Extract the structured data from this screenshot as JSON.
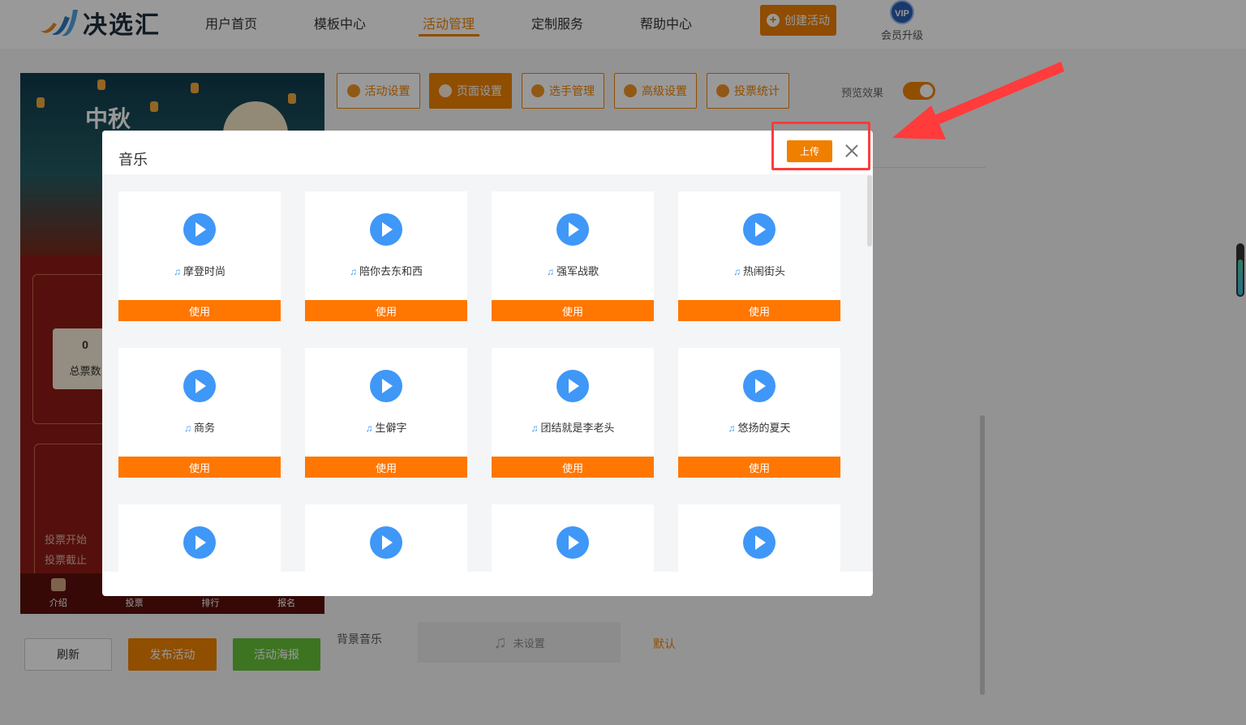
{
  "header": {
    "logo_text": "决选汇",
    "nav": [
      "用户首页",
      "模板中心",
      "活动管理",
      "定制服务",
      "帮助中心"
    ],
    "active_nav": "活动管理",
    "create_button": "创建活动",
    "vip_badge": "VIP",
    "vip_label": "会员升级"
  },
  "toolbar": {
    "buttons": [
      "活动设置",
      "页面设置",
      "选手管理",
      "高级设置",
      "投票统计"
    ],
    "active": "页面设置",
    "preview_label": "预览效果",
    "preview_on": true
  },
  "phone_preview": {
    "banner_text": "中秋",
    "vote_count": "0",
    "vote_count_label": "总票数",
    "vote_start_label": "投票开始",
    "vote_end_label": "投票截止",
    "tabs": [
      "介绍",
      "投票",
      "排行",
      "报名"
    ]
  },
  "background_music": {
    "label": "背景音乐",
    "value": "未设置",
    "default_link": "默认"
  },
  "bottom_buttons": {
    "refresh": "刷新",
    "publish": "发布活动",
    "poster": "活动海报"
  },
  "modal": {
    "title": "音乐",
    "upload_button": "上传",
    "use_label": "使用",
    "songs": [
      "摩登时尚",
      "陪你去东和西",
      "强军战歌",
      "热闹街头",
      "商务",
      "生僻字",
      "团结就是李老头",
      "悠扬的夏天",
      "",
      "",
      "",
      ""
    ]
  },
  "colors": {
    "accent": "#f08300",
    "use_button": "#ff7700",
    "play_icon": "#3f97f7",
    "poster_button": "#67c23a",
    "annotation": "#ff3b3b"
  }
}
